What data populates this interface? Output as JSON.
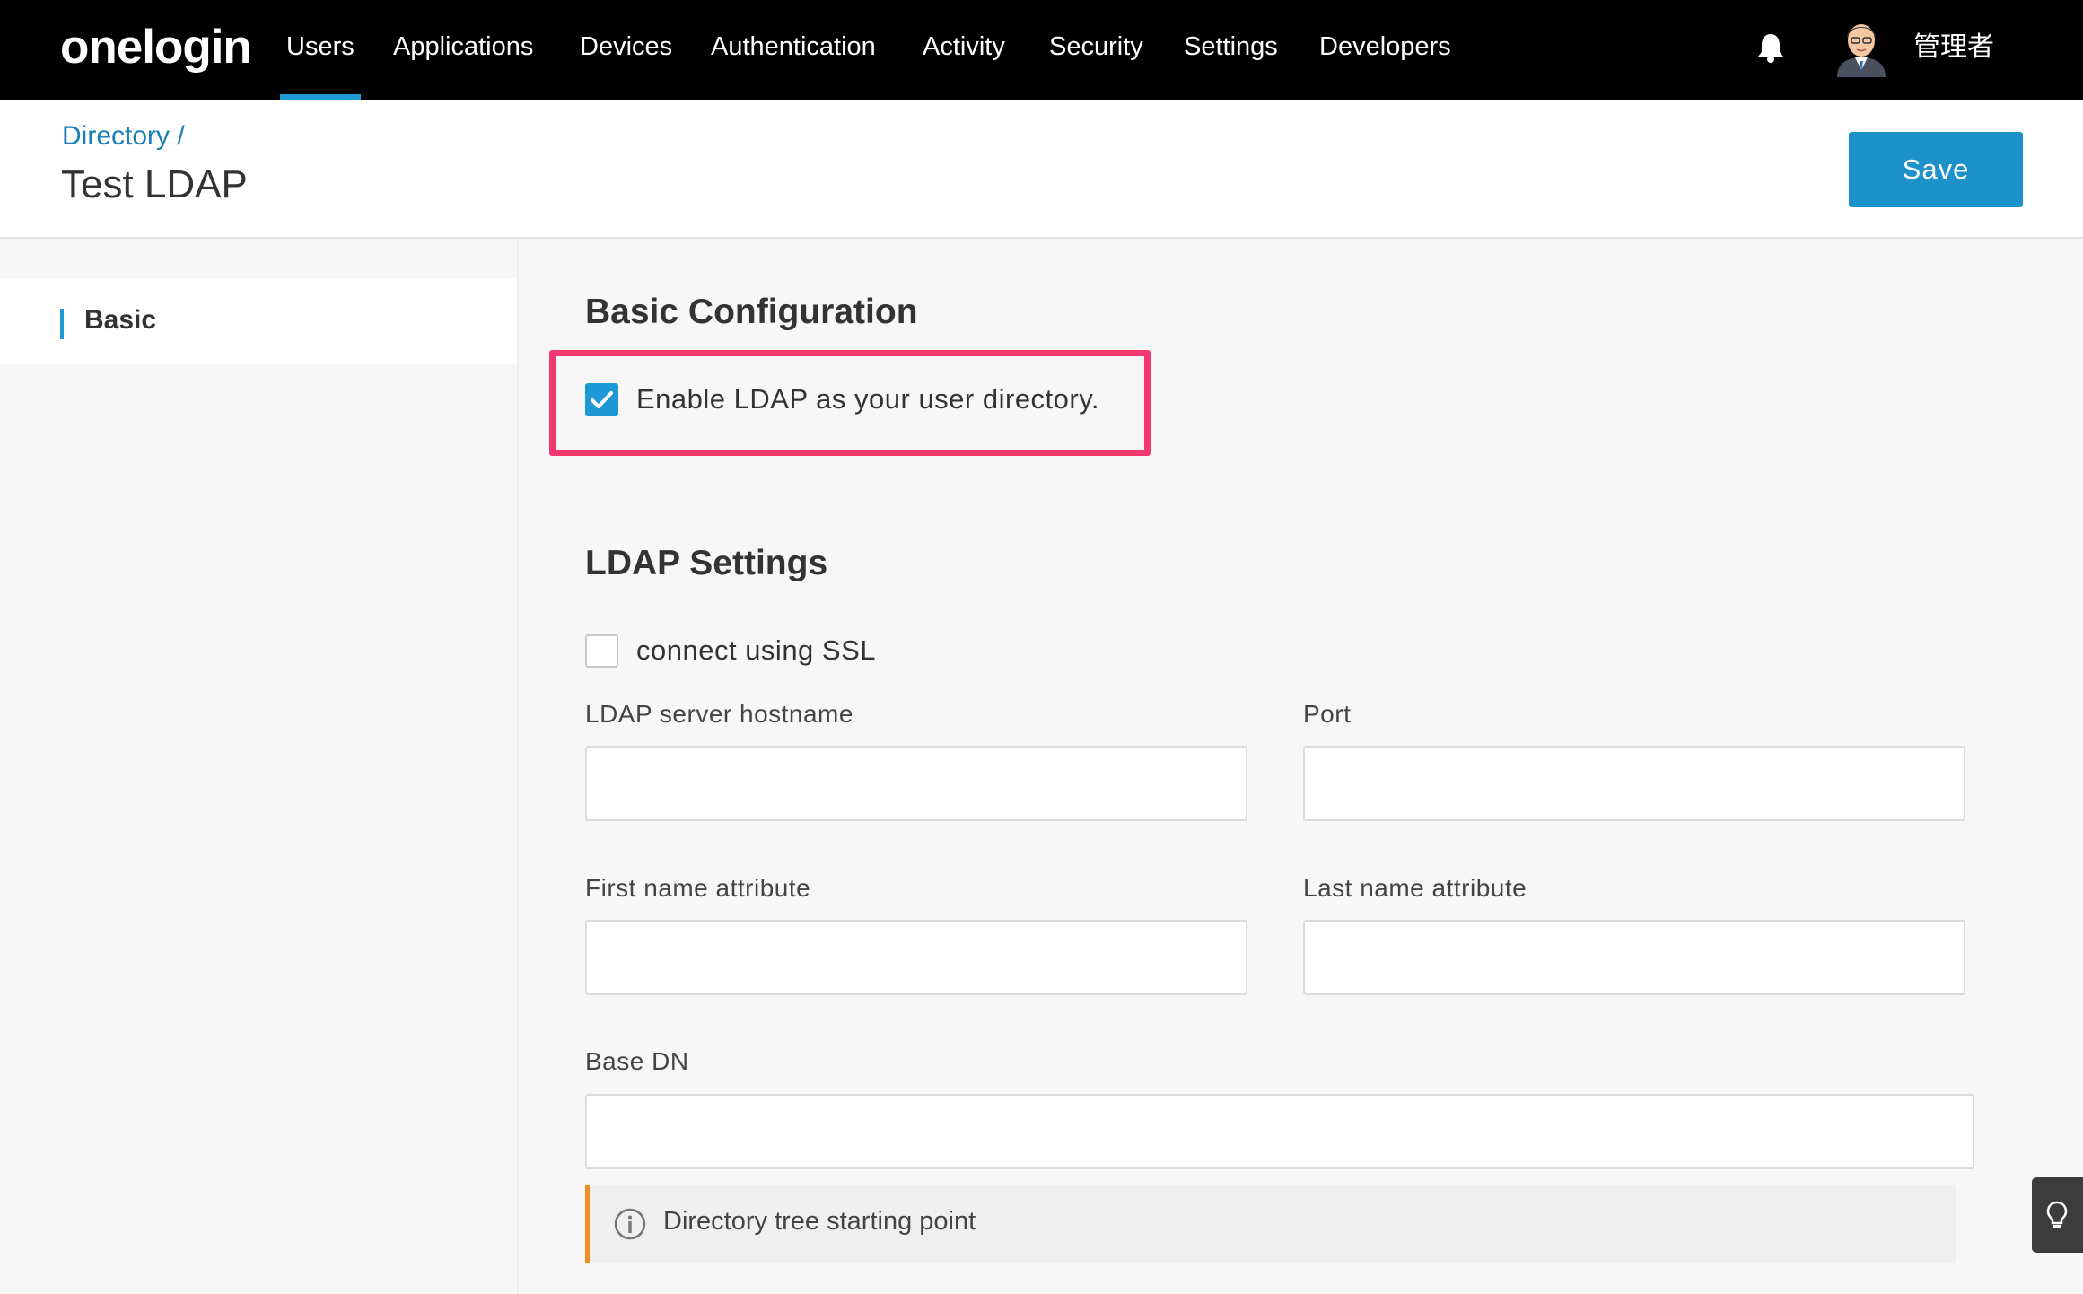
{
  "nav": {
    "logo": "onelogin",
    "items": [
      {
        "label": "Users",
        "active": true
      },
      {
        "label": "Applications",
        "active": false
      },
      {
        "label": "Devices",
        "active": false
      },
      {
        "label": "Authentication",
        "active": false
      },
      {
        "label": "Activity",
        "active": false
      },
      {
        "label": "Security",
        "active": false
      },
      {
        "label": "Settings",
        "active": false
      },
      {
        "label": "Developers",
        "active": false
      }
    ],
    "notification_icon": "bell-icon",
    "user_name": "管理者"
  },
  "header": {
    "breadcrumb": "Directory /",
    "title": "Test LDAP",
    "save_label": "Save"
  },
  "sidebar": {
    "items": [
      {
        "label": "Basic",
        "active": true
      }
    ]
  },
  "basic_config": {
    "title": "Basic Configuration",
    "enable_ldap": {
      "label": "Enable LDAP as your user directory.",
      "checked": true
    }
  },
  "ldap_settings": {
    "title": "LDAP Settings",
    "ssl": {
      "label": "connect using SSL",
      "checked": false
    },
    "hostname": {
      "label": "LDAP server hostname",
      "value": ""
    },
    "port": {
      "label": "Port",
      "value": ""
    },
    "first_name": {
      "label": "First name attribute",
      "value": ""
    },
    "last_name": {
      "label": "Last name attribute",
      "value": ""
    },
    "base_dn": {
      "label": "Base DN",
      "value": "",
      "hint": "Directory tree starting point"
    }
  },
  "colors": {
    "accent": "#1d9ad6",
    "highlight": "#f2386e",
    "hint_border": "#ef8f1f"
  }
}
